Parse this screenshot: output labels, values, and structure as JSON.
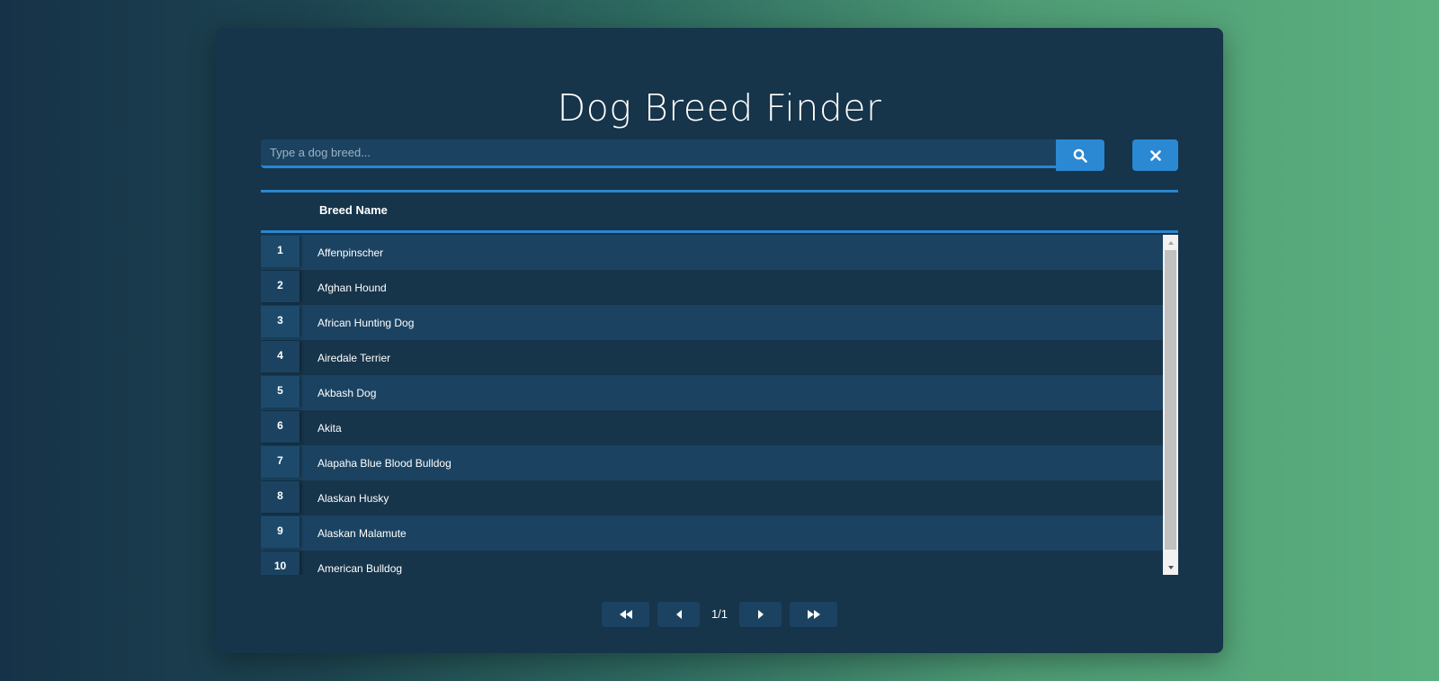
{
  "app": {
    "title": "Dog Breed Finder"
  },
  "search": {
    "placeholder": "Type a dog breed...",
    "value": "",
    "search_icon": "search-icon",
    "clear_icon": "close-icon"
  },
  "table": {
    "header_name": "Breed Name",
    "rows": [
      {
        "num": "1",
        "name": "Affenpinscher"
      },
      {
        "num": "2",
        "name": "Afghan Hound"
      },
      {
        "num": "3",
        "name": "African Hunting Dog"
      },
      {
        "num": "4",
        "name": "Airedale Terrier"
      },
      {
        "num": "5",
        "name": "Akbash Dog"
      },
      {
        "num": "6",
        "name": "Akita"
      },
      {
        "num": "7",
        "name": "Alapaha Blue Blood Bulldog"
      },
      {
        "num": "8",
        "name": "Alaskan Husky"
      },
      {
        "num": "9",
        "name": "Alaskan Malamute"
      },
      {
        "num": "10",
        "name": "American Bulldog"
      }
    ]
  },
  "pagination": {
    "label": "1/1",
    "first_icon": "double-chevron-left-icon",
    "prev_icon": "chevron-left-icon",
    "next_icon": "chevron-right-icon",
    "last_icon": "double-chevron-right-icon"
  },
  "colors": {
    "accent": "#2b88d3",
    "card": "#16344a",
    "row_alt": "#1b4361"
  }
}
